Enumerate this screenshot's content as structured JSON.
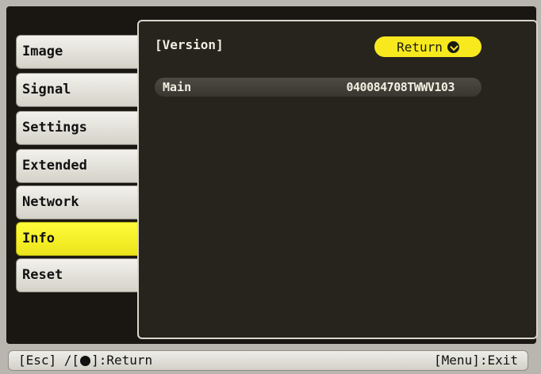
{
  "sidebar": {
    "items": [
      {
        "label": "Image"
      },
      {
        "label": "Signal"
      },
      {
        "label": "Settings"
      },
      {
        "label": "Extended"
      },
      {
        "label": "Network"
      },
      {
        "label": "Info",
        "active": true
      },
      {
        "label": "Reset"
      }
    ]
  },
  "panel": {
    "title": "[Version]",
    "return_label": "Return",
    "return_icon": "enter-icon",
    "rows": [
      {
        "label": "Main",
        "value": "040084708TWWV103"
      }
    ]
  },
  "footer": {
    "left_prefix": "[Esc] /[",
    "left_icon": "enter-icon",
    "left_suffix": "]:Return",
    "right": "[Menu]:Exit"
  },
  "colors": {
    "highlight": "#f7e91e",
    "panel_background": "#27241d",
    "tab_background": "#e6e4dc"
  }
}
